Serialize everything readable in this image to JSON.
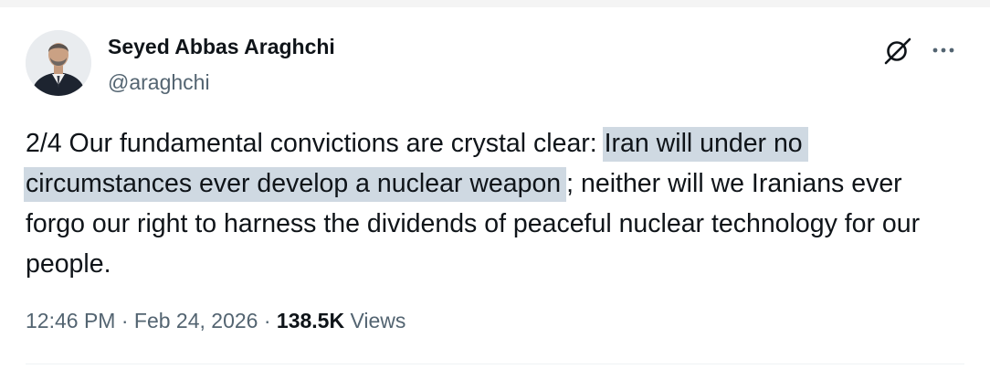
{
  "author": {
    "display_name": "Seyed Abbas Araghchi",
    "handle": "@araghchi"
  },
  "tweet": {
    "text_before": "2/4 Our fundamental convictions are crystal clear: ",
    "text_highlighted": "Iran will under no circumstances ever develop a nuclear weapon",
    "text_after": "; neither will we Iranians ever forgo our right to harness the dividends of peaceful nuclear technology for our people."
  },
  "meta": {
    "time": "12:46 PM",
    "separator_1": "·",
    "date": "Feb 24, 2026",
    "separator_2": "·",
    "views_count": "138.5K",
    "views_label": "Views"
  },
  "icons": {
    "grok": "grok-icon",
    "more": "more-dots-icon"
  },
  "colors": {
    "text_primary": "#0f1419",
    "text_secondary": "#536471",
    "highlight": "#cfd9e2"
  }
}
